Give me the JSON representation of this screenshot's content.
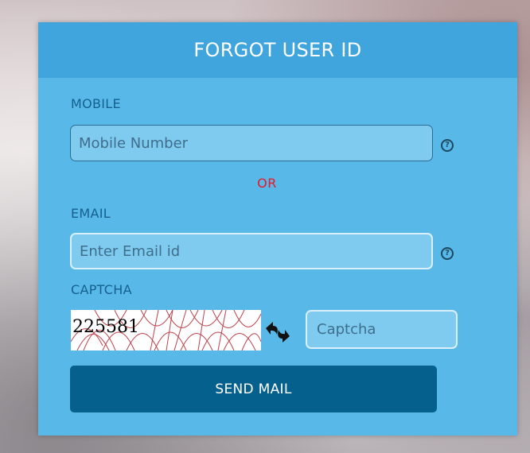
{
  "form": {
    "title": "FORGOT USER ID",
    "mobile": {
      "label": "MOBILE",
      "placeholder": "Mobile Number",
      "help_icon": "question-circle-icon"
    },
    "separator": "OR",
    "email": {
      "label": "EMAIL",
      "placeholder": "Enter Email id",
      "help_icon": "question-circle-icon"
    },
    "captcha": {
      "label": "CAPTCHA",
      "image_code": "225581",
      "refresh_icon": "refresh-arrows-icon",
      "placeholder": "Captcha"
    },
    "submit_label": "SEND MAIL"
  },
  "colors": {
    "panel": "#58b9e9",
    "header": "#3fa5dc",
    "label": "#15608f",
    "or": "#e8182a",
    "button": "#06608d"
  }
}
